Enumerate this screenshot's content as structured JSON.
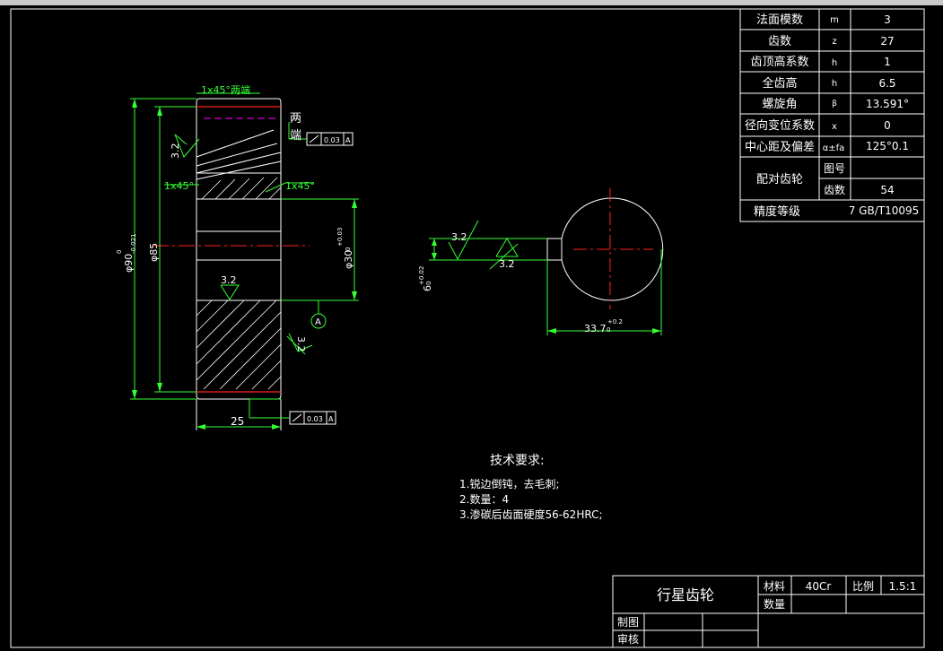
{
  "params": {
    "rows": [
      {
        "name": "法面模数",
        "sym": "m",
        "val": "3"
      },
      {
        "name": "齿数",
        "sym": "z",
        "val": "27"
      },
      {
        "name": "齿顶高系数",
        "sym": "h",
        "val": "1"
      },
      {
        "name": "全齿高",
        "sym": "h",
        "val": "6.5"
      },
      {
        "name": "螺旋角",
        "sym": "β",
        "val": "13.591°"
      },
      {
        "name": "径向变位系数",
        "sym": "x",
        "val": "0"
      },
      {
        "name": "中心距及偏差",
        "sym": "α±fa",
        "val": "125°0.1"
      }
    ],
    "mate_label": "配对齿轮",
    "mate_rows": [
      {
        "name": "图号",
        "val": ""
      },
      {
        "name": "齿数",
        "val": "54"
      }
    ],
    "accuracy_label": "精度等级",
    "accuracy_val": "7 GB/T10095"
  },
  "drawing": {
    "chamfer_top": "1x45°两端",
    "chamfer_left": "1x45°",
    "chamfer_right": "1x45°",
    "both_ends_1": "两",
    "both_ends_2": "端",
    "rough_32": "3.2",
    "runout_val": "0.03",
    "datum": "A",
    "dim_d90": "φ90",
    "dim_d90_tol_up": "0",
    "dim_d90_tol_dn": "-0.021",
    "dim_d85": "φ85",
    "dim_d30": "φ30",
    "dim_d30_tol": "+0.03",
    "dim_d30_tol0": "0",
    "dim_width": "25",
    "keyway_width": "6",
    "keyway_tol": "+0.02",
    "keyway_tol0": "0",
    "keyway_depth": "33.7",
    "keyway_depth_tol": "+0.2",
    "keyway_depth_tol0": "0"
  },
  "requirements": {
    "title": "技术要求:",
    "items": [
      "1.锐边倒钝，去毛刺;",
      "2.数量：4",
      "3.渗碳后齿面硬度56-62HRC;"
    ]
  },
  "title_block": {
    "name": "行星齿轮",
    "material_label": "材料",
    "material_val": "40Cr",
    "scale_label": "比例",
    "scale_val": "1.5:1",
    "qty_label": "数量",
    "drawn_label": "制图",
    "checked_label": "审核"
  }
}
